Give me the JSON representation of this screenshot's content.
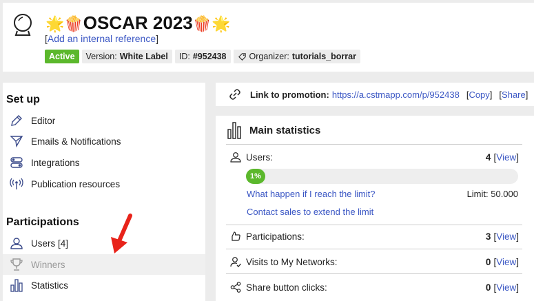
{
  "header": {
    "title_prefix": "🌟🍿",
    "title_text": "OSCAR 2023",
    "title_suffix": "🍿🌟",
    "ref_link": "Add an internal reference",
    "status": "Active",
    "version_label": "Version:",
    "version_value": "White Label",
    "id_label": "ID:",
    "id_value": "#952438",
    "organizer_label": "Organizer:",
    "organizer_value": "tutorials_borrar"
  },
  "sidebar": {
    "setup_title": "Set up",
    "setup_items": [
      {
        "label": "Editor",
        "icon": "pencil-icon"
      },
      {
        "label": "Emails & Notifications",
        "icon": "paper-plane-icon"
      },
      {
        "label": "Integrations",
        "icon": "toggles-icon"
      },
      {
        "label": "Publication resources",
        "icon": "broadcast-icon"
      }
    ],
    "participations_title": "Participations",
    "participation_items": [
      {
        "label": "Users [4]",
        "icon": "user-icon"
      },
      {
        "label": "Winners",
        "icon": "trophy-icon"
      },
      {
        "label": "Statistics",
        "icon": "bar-chart-icon"
      }
    ]
  },
  "link_bar": {
    "label": "Link to promotion:",
    "url": "https://a.cstmapp.com/p/952438",
    "copy": "Copy",
    "share": "Share"
  },
  "stats": {
    "title": "Main statistics",
    "users_label": "Users:",
    "users_value": "4",
    "view": "View",
    "progress_label": "1%",
    "progress_fraction": 0.01,
    "limit_question": "What happen if I reach the limit?",
    "limit_text": "Limit: 50.000",
    "contact_sales": "Contact sales to extend the limit",
    "participations_label": "Participations:",
    "participations_value": "3",
    "visits_label": "Visits to My Networks:",
    "visits_value": "0",
    "share_label": "Share button clicks:",
    "share_value": "0"
  },
  "colors": {
    "accent_green": "#5bb82c",
    "link_blue": "#3b57c4",
    "annotation_red": "#e8231a"
  }
}
